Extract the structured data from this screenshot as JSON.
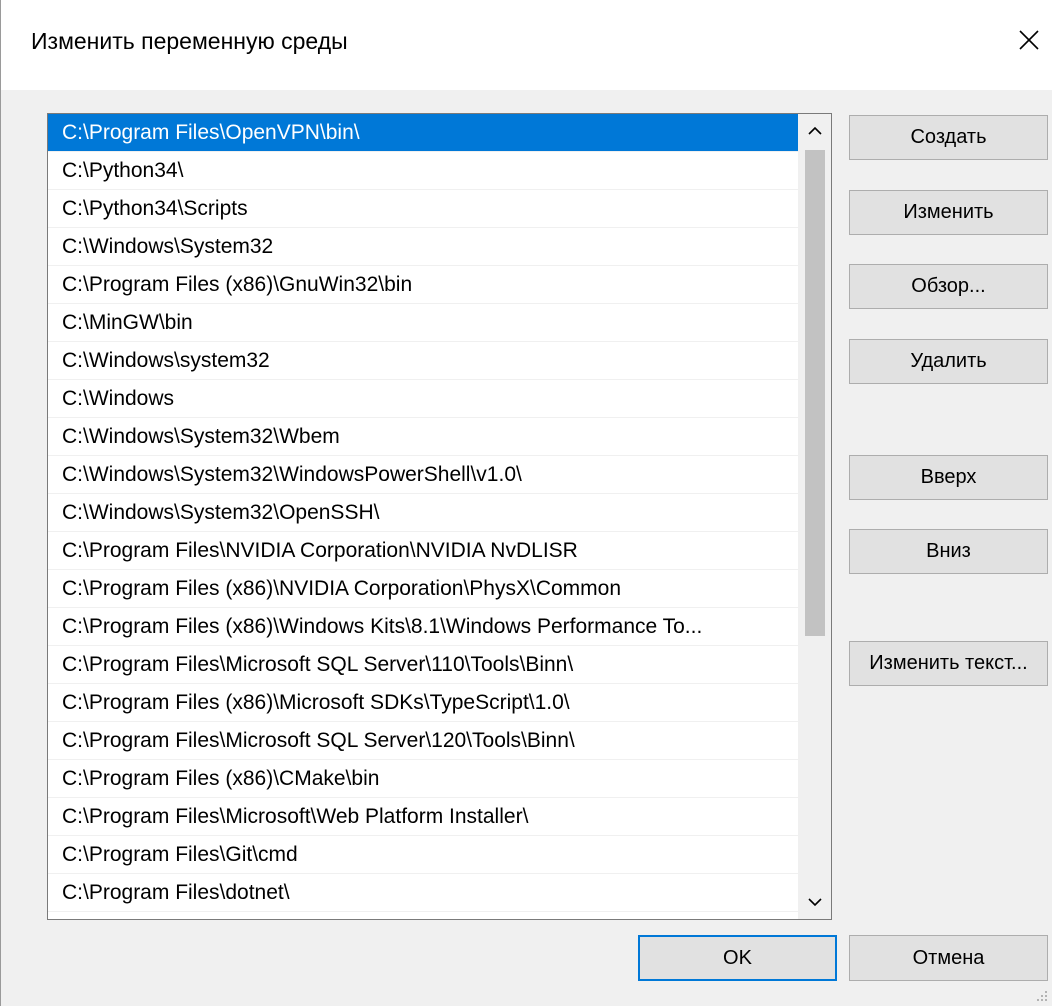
{
  "window": {
    "title": "Изменить переменную среды"
  },
  "list": {
    "items": [
      "C:\\Program Files\\OpenVPN\\bin\\",
      "C:\\Python34\\",
      "C:\\Python34\\Scripts",
      "C:\\Windows\\System32",
      "C:\\Program Files (x86)\\GnuWin32\\bin",
      "C:\\MinGW\\bin",
      "C:\\Windows\\system32",
      "C:\\Windows",
      "C:\\Windows\\System32\\Wbem",
      "C:\\Windows\\System32\\WindowsPowerShell\\v1.0\\",
      "C:\\Windows\\System32\\OpenSSH\\",
      "C:\\Program Files\\NVIDIA Corporation\\NVIDIA NvDLISR",
      "C:\\Program Files (x86)\\NVIDIA Corporation\\PhysX\\Common",
      "C:\\Program Files (x86)\\Windows Kits\\8.1\\Windows Performance To...",
      "C:\\Program Files\\Microsoft SQL Server\\110\\Tools\\Binn\\",
      "C:\\Program Files (x86)\\Microsoft SDKs\\TypeScript\\1.0\\",
      "C:\\Program Files\\Microsoft SQL Server\\120\\Tools\\Binn\\",
      "C:\\Program Files (x86)\\CMake\\bin",
      "C:\\Program Files\\Microsoft\\Web Platform Installer\\",
      "C:\\Program Files\\Git\\cmd",
      "C:\\Program Files\\dotnet\\"
    ],
    "selected_index": 0
  },
  "buttons": {
    "create": "Создать",
    "edit": "Изменить",
    "browse": "Обзор...",
    "delete": "Удалить",
    "up": "Вверх",
    "down": "Вниз",
    "edit_text": "Изменить текст...",
    "ok": "OK",
    "cancel": "Отмена"
  },
  "colors": {
    "selection": "#0078d7",
    "dialog_bg": "#f0f0f0",
    "button_bg": "#e1e1e1"
  }
}
